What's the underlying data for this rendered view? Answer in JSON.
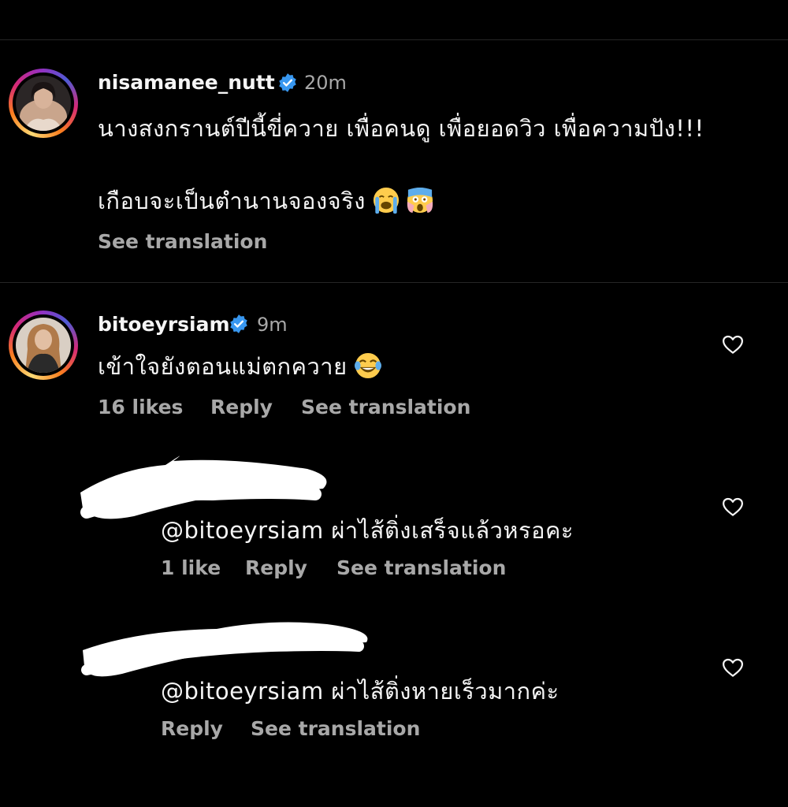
{
  "post": {
    "username": "nisamanee_nutt",
    "time": "20m",
    "caption_line1": "นางสงกรานต์ปีนี้ขี่ควาย เพื่อคนดู เพื่อยอดวิว เพื่อความปัง!!!",
    "caption_line2": "เกือบจะเป็นตำนานจองจริง",
    "caption_emojis": [
      "loudly-crying-face",
      "screaming-face"
    ],
    "see_translation": "See translation"
  },
  "comments": [
    {
      "username": "bitoeyrsiam",
      "time": "9m",
      "text": "เข้าใจยังตอนแม่ตกควาย",
      "emoji": "tears-of-joy-face",
      "likes": "16 likes",
      "reply": "Reply",
      "see_translation": "See translation"
    }
  ],
  "replies": [
    {
      "text": "@bitoeyrsiam ผ่าไส้ติ่งเสร็จแล้วหรอคะ",
      "likes": "1 like",
      "reply": "Reply",
      "see_translation": "See translation"
    },
    {
      "text": "@bitoeyrsiam ผ่าไส้ติ่งหายเร็วมากค่ะ",
      "reply": "Reply",
      "see_translation": "See translation"
    }
  ],
  "icons": {
    "verified": "verified-badge-icon",
    "like": "heart-outline-icon"
  },
  "colors": {
    "background": "#000000",
    "text": "#f5f5f5",
    "secondary": "#a8a8a8",
    "verified": "#3897f0",
    "divider": "#262626"
  }
}
